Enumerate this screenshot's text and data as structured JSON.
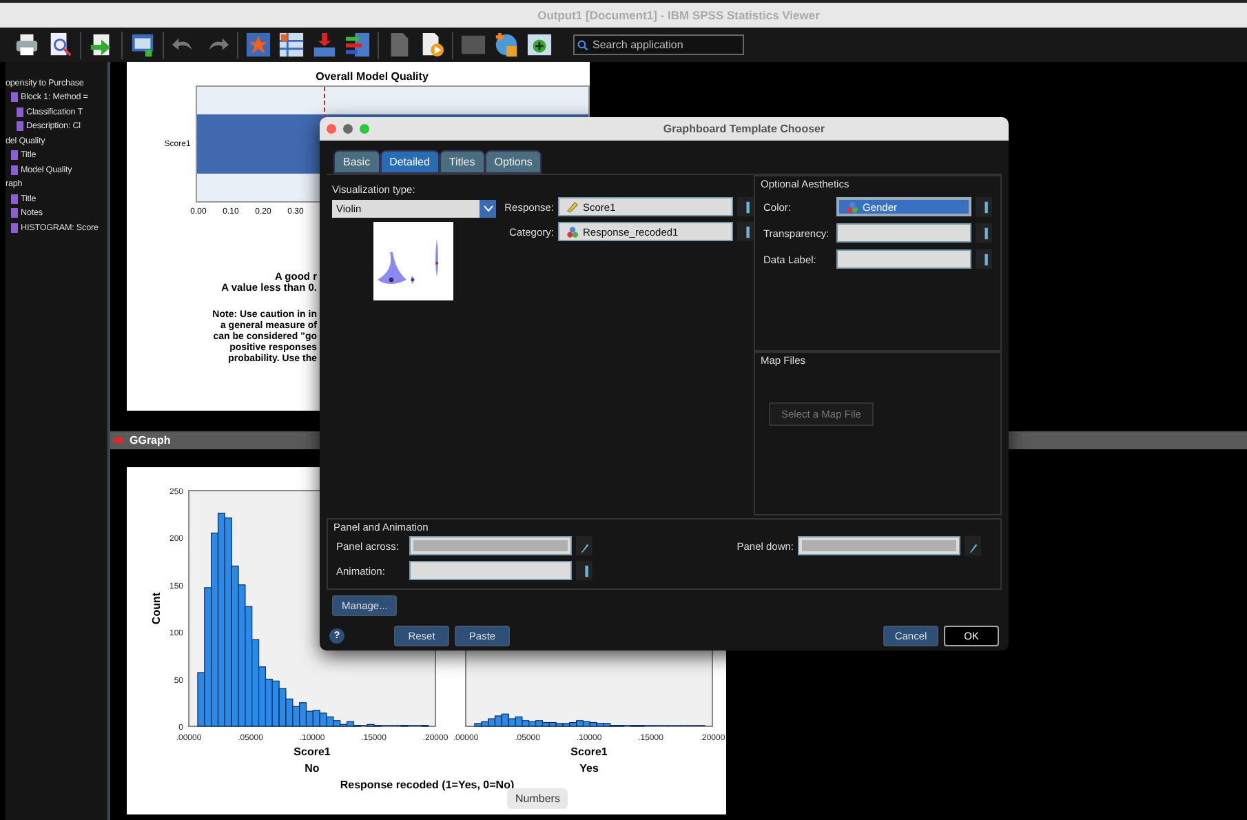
{
  "window": {
    "title": "Output1 [Document1] - IBM SPSS Statistics Viewer"
  },
  "toolbar": {
    "search": {
      "placeholder": "Search application"
    }
  },
  "outline": [
    {
      "label": "opensity to Purchase",
      "children": [
        {
          "label": "Block 1: Method =",
          "children": [
            {
              "label": "Classification T"
            },
            {
              "label": "Description: Cl"
            }
          ]
        }
      ]
    },
    {
      "label": "del Quality",
      "children": [
        {
          "label": "Title"
        },
        {
          "label": "Model Quality"
        }
      ]
    },
    {
      "label": "raph",
      "children": [
        {
          "label": "Title"
        },
        {
          "label": "Notes"
        },
        {
          "label": "HISTOGRAM: Score"
        }
      ]
    }
  ],
  "model_quality": {
    "title": "Overall Model Quality",
    "row_label": "Score1",
    "ticks": [
      "0.00",
      "0.10",
      "0.20",
      "0.30"
    ],
    "notes": [
      {
        "text": "A good r",
        "kind": "heading"
      },
      {
        "text": "A value less than 0.",
        "kind": "heading"
      },
      {
        "text": "Note: Use caution in in",
        "kind": "body"
      },
      {
        "text": "a general measure of",
        "kind": "body"
      },
      {
        "text": "can be considered \"go",
        "kind": "body"
      },
      {
        "text": "positive responses",
        "kind": "body"
      },
      {
        "text": "probability. Use the",
        "kind": "body"
      }
    ]
  },
  "output_heading": {
    "label": "GGraph"
  },
  "histogram": {
    "footer": "Response recoded (1=Yes, 0=No)",
    "panels": [
      {
        "group": "No",
        "chart_data": {
          "type": "bar",
          "xlabel": "Score1",
          "ylabel": "Count",
          "xlim": [
            0,
            0.2
          ],
          "ylim": [
            0,
            250
          ],
          "xticks": [
            {
              "value": 0,
              "label": ".00000"
            },
            {
              "value": 0.05,
              "label": ".05000"
            },
            {
              "value": 0.1,
              "label": ".10000"
            },
            {
              "value": 0.15,
              "label": ".15000"
            },
            {
              "value": 0.2,
              "label": ".20000"
            }
          ],
          "yticks": [
            0,
            50,
            100,
            150,
            200,
            250
          ],
          "x": [
            0.01,
            0.0155,
            0.021,
            0.0265,
            0.032,
            0.0375,
            0.043,
            0.0485,
            0.054,
            0.0595,
            0.065,
            0.0705,
            0.076,
            0.0815,
            0.087,
            0.0925,
            0.098,
            0.1035,
            0.109,
            0.1145,
            0.12,
            0.1255,
            0.131,
            0.1365,
            0.142,
            0.1475,
            0.153,
            0.1585,
            0.164,
            0.1695,
            0.175,
            0.1805,
            0.186,
            0.1915
          ],
          "values": [
            57,
            147,
            205,
            226,
            221,
            170,
            150,
            127,
            92,
            63,
            50,
            48,
            40,
            29,
            21,
            25,
            16,
            17,
            14,
            10,
            6,
            2,
            5,
            1,
            0,
            2,
            1,
            0,
            0,
            0,
            1,
            0,
            0,
            1
          ]
        }
      },
      {
        "group": "Yes",
        "chart_data": {
          "type": "bar",
          "xlabel": "Score1",
          "xlim": [
            0,
            0.2
          ],
          "ylim": [
            0,
            250
          ],
          "xticks": [
            {
              "value": 0,
              "label": ".00000"
            },
            {
              "value": 0.05,
              "label": ".05000"
            },
            {
              "value": 0.1,
              "label": ".10000"
            },
            {
              "value": 0.15,
              "label": ".15000"
            },
            {
              "value": 0.2,
              "label": ".20000"
            }
          ],
          "x": [
            0.01,
            0.0155,
            0.021,
            0.0265,
            0.032,
            0.0375,
            0.043,
            0.0485,
            0.054,
            0.0595,
            0.065,
            0.0705,
            0.076,
            0.0815,
            0.087,
            0.0925,
            0.098,
            0.1035,
            0.109,
            0.1145,
            0.12,
            0.1255,
            0.131,
            0.1365,
            0.142,
            0.1475,
            0.153,
            0.1585,
            0.164,
            0.1695,
            0.175,
            0.1805,
            0.186,
            0.1915
          ],
          "values": [
            3,
            5,
            8,
            11,
            13,
            8,
            10,
            6,
            5,
            6,
            4,
            4,
            3,
            3,
            4,
            6,
            5,
            4,
            3,
            3,
            1,
            1,
            0,
            1,
            1,
            0,
            0,
            0,
            0,
            0,
            0,
            0,
            0,
            0
          ]
        }
      }
    ]
  },
  "dialog": {
    "title": "Graphboard Template Chooser",
    "tabs": [
      {
        "label": "Basic",
        "selected": false
      },
      {
        "label": "Detailed",
        "selected": true
      },
      {
        "label": "Titles",
        "selected": false
      },
      {
        "label": "Options",
        "selected": false
      }
    ],
    "visualization_type": {
      "label": "Visualization type:",
      "value": "Violin"
    },
    "variables": [
      {
        "label": "Response:",
        "value": "Score1",
        "kind": "scale"
      },
      {
        "label": "Category:",
        "value": "Response_recoded1",
        "kind": "nominal"
      }
    ],
    "optional_aesthetics": {
      "title": "Optional Aesthetics",
      "fields": [
        {
          "label": "Color:",
          "value": "Gender",
          "kind": "nominal",
          "selected": true
        },
        {
          "label": "Transparency:",
          "selected": false
        },
        {
          "label": "Data Label:",
          "selected": false
        }
      ]
    },
    "map_files": {
      "title": "Map Files",
      "button": {
        "label": "Select a Map File",
        "disabled": true
      }
    },
    "panel_animation": {
      "title": "Panel and Animation",
      "fields": [
        {
          "label": "Panel across:",
          "disabled": true
        },
        {
          "label": "Panel down:",
          "disabled": true
        },
        {
          "label": "Animation:",
          "disabled": false
        }
      ]
    },
    "buttons": {
      "manage": "Manage...",
      "help": "?",
      "reset": "Reset",
      "paste": "Paste",
      "cancel": "Cancel",
      "ok": "OK"
    }
  },
  "tooltip": {
    "text": "Numbers"
  }
}
